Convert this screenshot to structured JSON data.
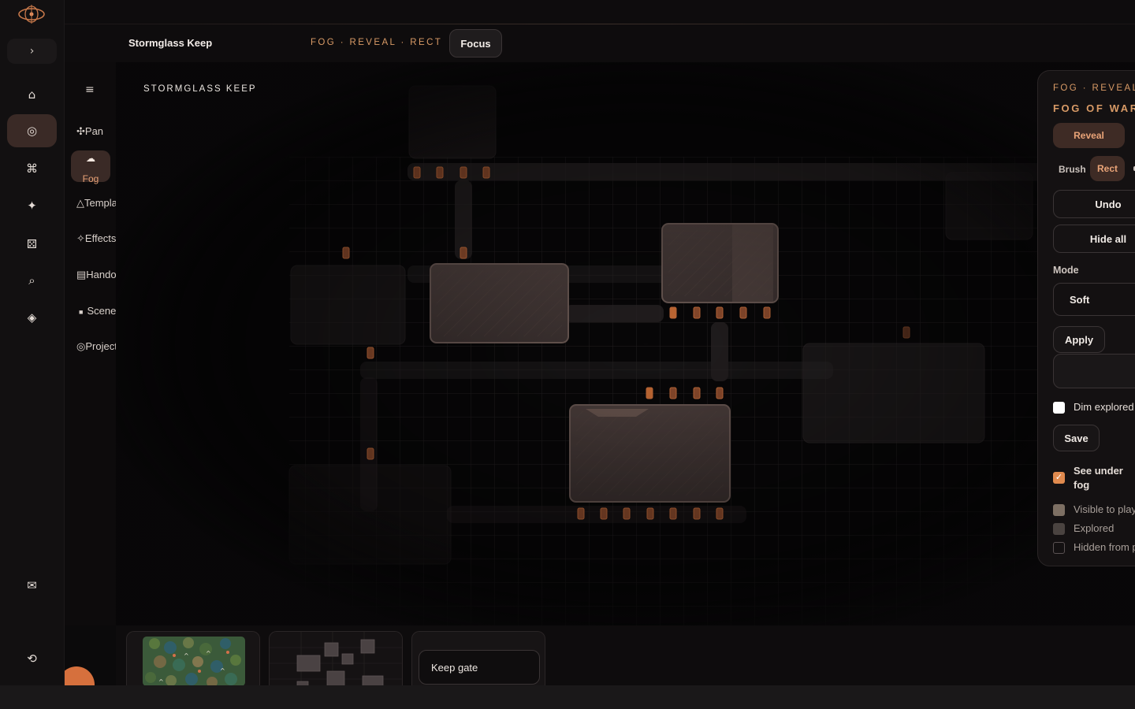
{
  "app": {
    "title": "Stormglass Keep"
  },
  "header": {
    "breadcrumb": "FOG · REVEAL · RECT",
    "focus_label": "Focus"
  },
  "rail": {
    "icons": [
      {
        "name": "home-icon",
        "glyph": "⌂"
      },
      {
        "name": "target-icon",
        "glyph": "◎",
        "active": true
      },
      {
        "name": "command-icon",
        "glyph": "⌘"
      },
      {
        "name": "sparkle-icon",
        "glyph": "✦"
      },
      {
        "name": "dice-icon",
        "glyph": "⚄"
      },
      {
        "name": "search-icon",
        "glyph": "⌕"
      },
      {
        "name": "diamond-icon",
        "glyph": "◈"
      },
      {
        "name": "mail-icon",
        "glyph": "✉"
      },
      {
        "name": "history-icon",
        "glyph": "⟲"
      }
    ]
  },
  "tools": {
    "items": [
      {
        "label": "Pan",
        "glyph": "✣"
      },
      {
        "label": "Fog",
        "glyph": "☁",
        "active": true
      },
      {
        "label": "Template",
        "glyph": "△"
      },
      {
        "label": "Effects",
        "glyph": "✧"
      },
      {
        "label": "Handout",
        "glyph": "▤"
      },
      {
        "label": "Scenes",
        "glyph": "■"
      },
      {
        "label": "Projector",
        "glyph": "◎"
      }
    ]
  },
  "canvas": {
    "map_name": "STORMGLASS KEEP"
  },
  "panel": {
    "breadcrumb": "FOG · REVEAL",
    "title": "FOG OF WAR",
    "reveal_label": "Reveal",
    "brush_label": "Brush",
    "rect_label": "Rect",
    "undo_label": "Undo",
    "hide_all_label": "Hide all",
    "mode_label": "Mode",
    "mode_value": "Soft",
    "apply_label": "Apply",
    "dim_explored_label": "Dim explored",
    "save_label": "Save",
    "see_under_fog_label": "See under fog",
    "legend": [
      {
        "label": "Visible to players",
        "color": "#7d6f63"
      },
      {
        "label": "Explored",
        "color": "#4a4340"
      },
      {
        "label": "Hidden from players",
        "color": "#141112"
      }
    ]
  },
  "tray": {
    "scene_input_value": "Keep gate"
  },
  "colors": {
    "accent": "#d89a66",
    "active_bg": "#3a2a26",
    "orb": "#d6703d"
  }
}
